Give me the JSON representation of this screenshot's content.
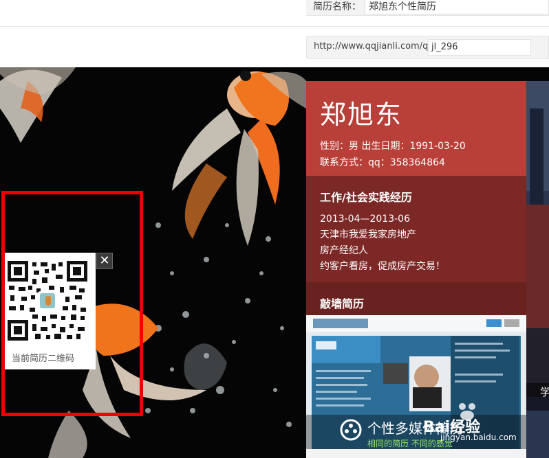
{
  "form": {
    "name_label": "简历名称：",
    "name_value": "郑旭东个性简历",
    "url_prefix": "http://www.qqjianli.com/qq",
    "url_suffix_value": "jl_296"
  },
  "resume": {
    "name": "郑旭东",
    "info_line1": "性别：男 出生日期：1991-03-20",
    "info_line2": "联系方式：qq：358364864",
    "section1_title": "工作/社会实践经历",
    "section1_lines": [
      "2013-04—2013-06",
      "天津市我爱我家房地产",
      "房产经纪人",
      "约客户看房，促成房产交易！"
    ],
    "section2_title": "敲墙简历"
  },
  "qr": {
    "caption": "当前简历二维码",
    "close_symbol": "✕"
  },
  "right_strip_label": "学",
  "watermark": {
    "title": "个性多媒体简历",
    "subtitle": "相同的简历  不同的感觉",
    "logo": "Bai经验",
    "url": "jingyan.baidu.com"
  },
  "colors": {
    "card_head": "#b84039",
    "card_section1": "#7b2826",
    "card_section2": "#6a2220",
    "highlight_frame": "#f10000"
  },
  "icons": [
    "qr-code-icon",
    "close-icon",
    "baidu-paw-icon",
    "film-reel-icon"
  ]
}
